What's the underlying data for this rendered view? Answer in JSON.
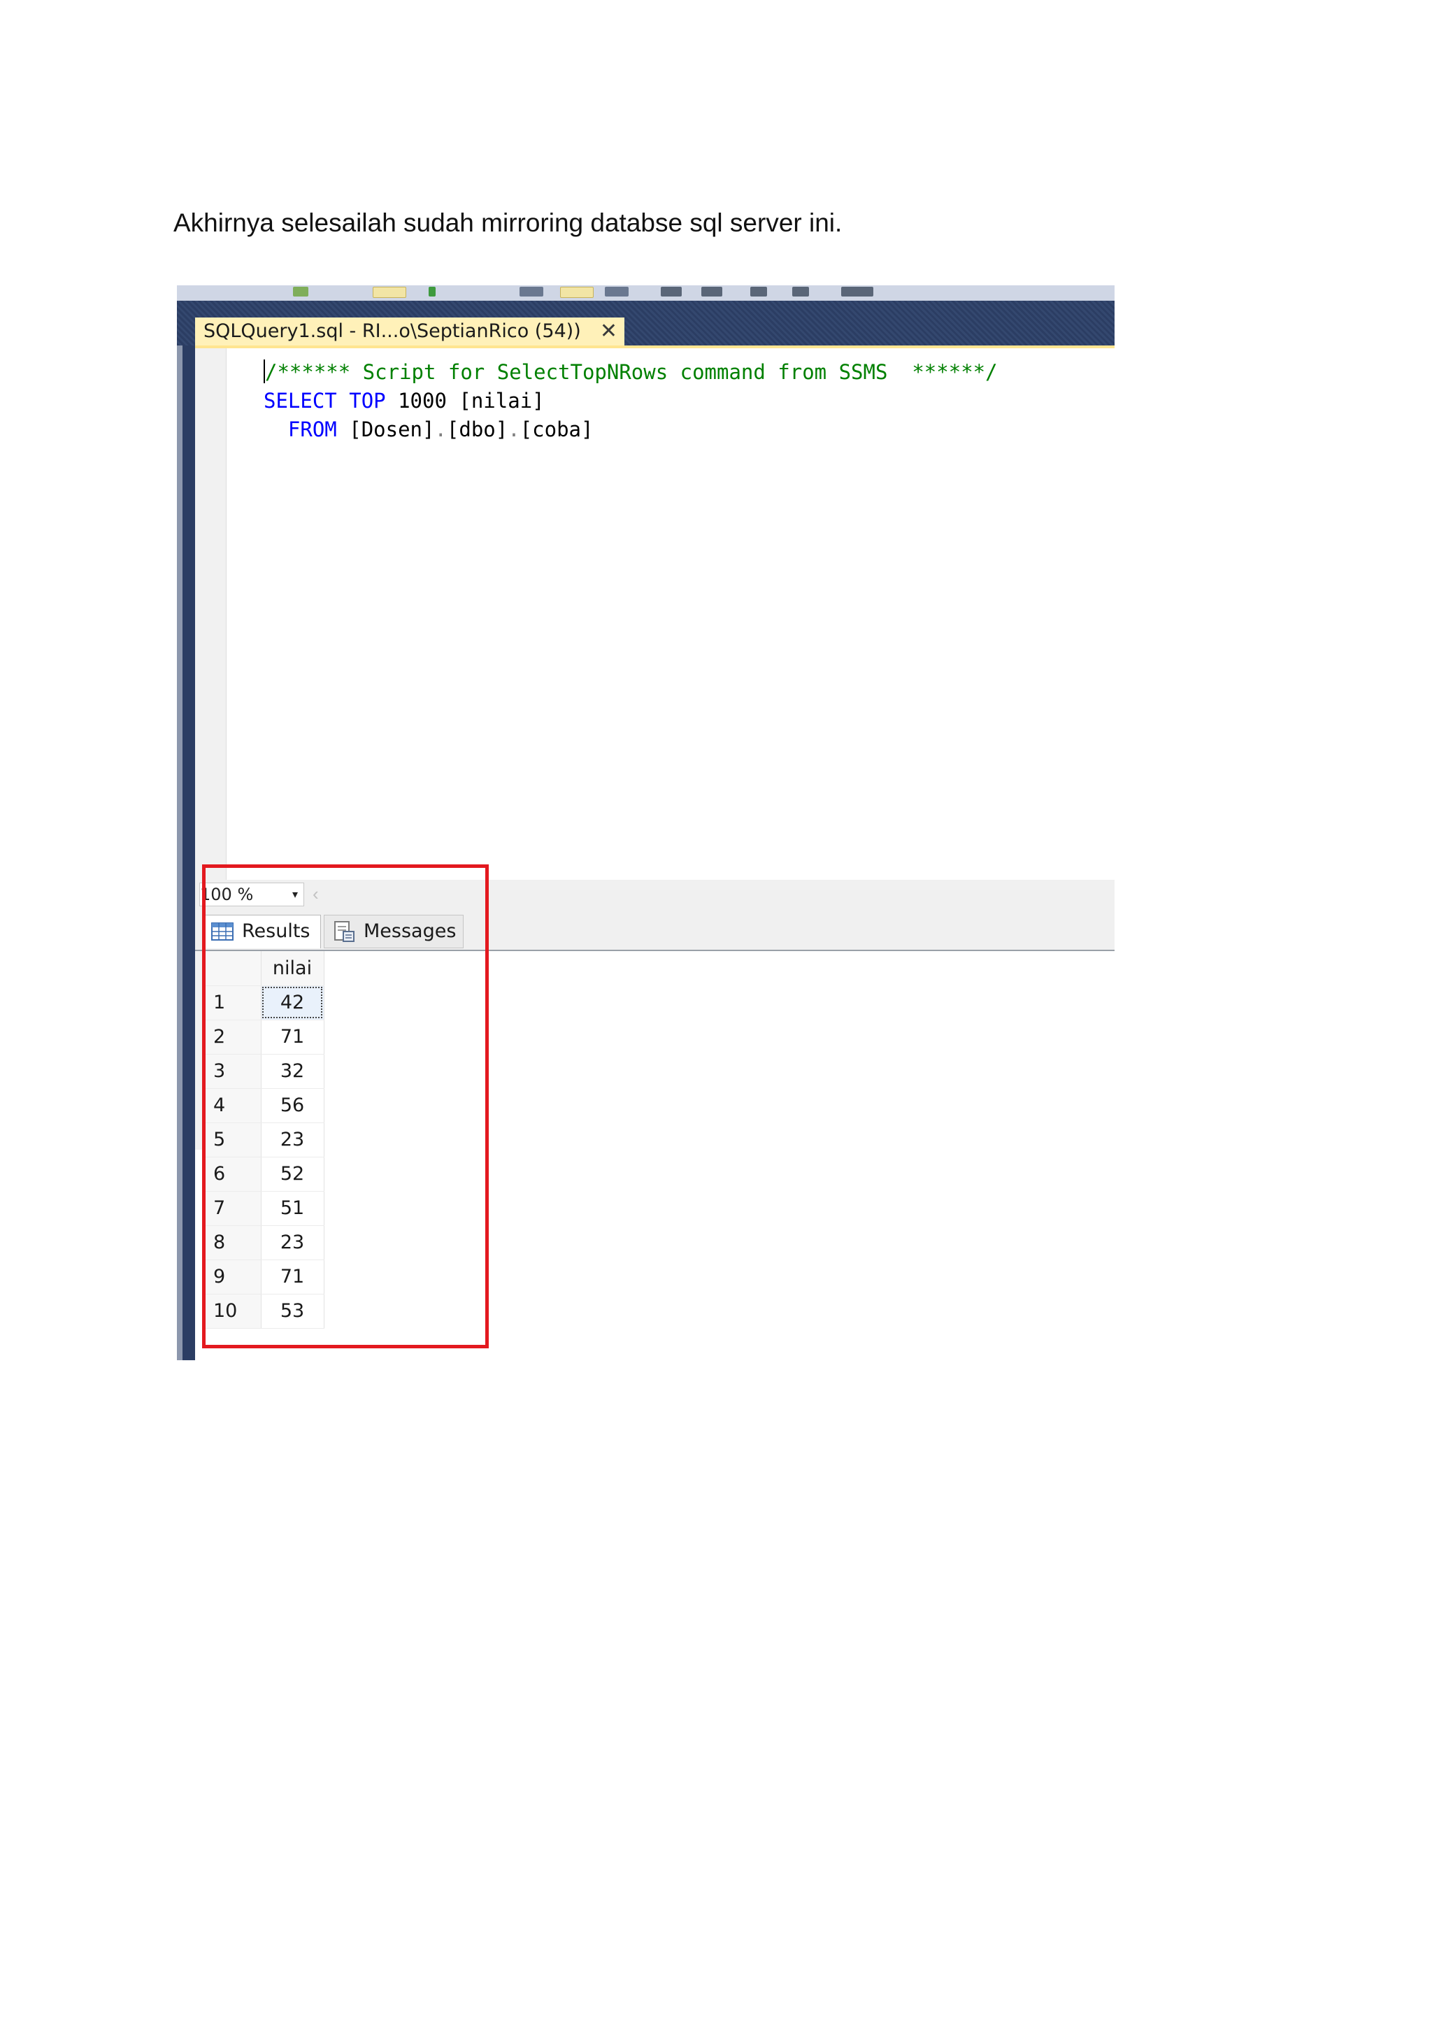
{
  "intro_text": "Akhirnya selesailah sudah mirroring databse sql server ini.",
  "editor": {
    "tab_title": "SQLQuery1.sql - RI...o\\SeptianRico (54))",
    "tab_close": "✕",
    "code": {
      "line1": "/****** Script for SelectTopNRows command from SSMS  ******/",
      "line2_kw1": "SELECT",
      "line2_kw2": "TOP",
      "line2_rest": "1000 [nilai]",
      "line3_kw": "FROM",
      "line3_p1": "[Dosen]",
      "line3_dot1": ".",
      "line3_p2": "[dbo]",
      "line3_dot2": ".",
      "line3_p3": "[coba]"
    }
  },
  "results": {
    "zoom": "100 %",
    "zoom_arrow": "▾",
    "scroll_left": "‹",
    "tabs": {
      "results_label": "Results",
      "messages_label": "Messages"
    },
    "column_header": "nilai",
    "rows": [
      {
        "n": "1",
        "v": "42"
      },
      {
        "n": "2",
        "v": "71"
      },
      {
        "n": "3",
        "v": "32"
      },
      {
        "n": "4",
        "v": "56"
      },
      {
        "n": "5",
        "v": "23"
      },
      {
        "n": "6",
        "v": "52"
      },
      {
        "n": "7",
        "v": "51"
      },
      {
        "n": "8",
        "v": "23"
      },
      {
        "n": "9",
        "v": "71"
      },
      {
        "n": "10",
        "v": "53"
      }
    ]
  },
  "colors": {
    "highlight_box": "#e3191f",
    "tab_active": "#fff1b9",
    "frame_dark": "#2b3d63"
  }
}
